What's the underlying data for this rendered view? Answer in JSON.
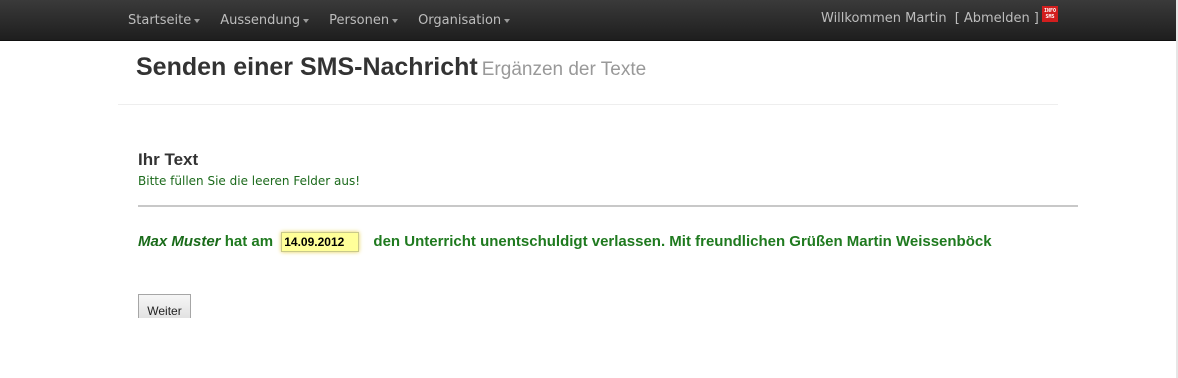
{
  "navbar": {
    "items": [
      {
        "label": "Startseite"
      },
      {
        "label": "Aussendung"
      },
      {
        "label": "Personen"
      },
      {
        "label": "Organisation"
      }
    ],
    "welcome_text": "Willkommen Martin",
    "bracket_open": "[",
    "logout_label": "Abmelden",
    "bracket_close": "]",
    "logo_icon": "info-sms-logo-icon"
  },
  "header": {
    "title": "Senden einer SMS-Nachricht",
    "subtitle": "Ergänzen der Texte"
  },
  "section": {
    "title": "Ihr Text",
    "hint": "Bitte füllen Sie die leeren Felder aus!"
  },
  "message": {
    "name": "Max Muster",
    "before_date": "hat am",
    "date_value": "14.09.2012",
    "after_date": "den Unterricht unentschuldigt verlassen. Mit freundlichen Grüßen Martin Weissenböck"
  },
  "form": {
    "submit_label": "Weiter"
  },
  "colors": {
    "accent_green": "#1f7a1f",
    "navbar_bg": "#222222",
    "input_highlight": "#ffff99"
  }
}
